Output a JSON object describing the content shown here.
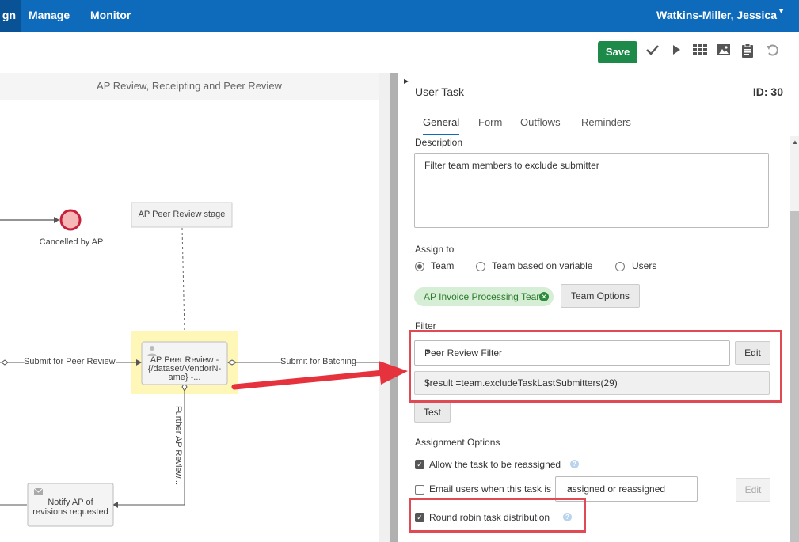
{
  "topbar": {
    "nav_partial": "gn",
    "nav_manage": "Manage",
    "nav_monitor": "Monitor",
    "user": "Watkins-Miller, Jessica"
  },
  "toolbar": {
    "save_label": "Save",
    "icons": [
      "check-icon",
      "play-icon",
      "grid-icon",
      "image-icon",
      "clipboard-icon",
      "undo-icon"
    ]
  },
  "canvas": {
    "header": "AP Review, Receipting and Peer Review",
    "nodes": {
      "cancelled": "Cancelled by AP",
      "stage": "AP Peer Review stage",
      "task_line1": "AP Peer Review -",
      "task_line2": "{/dataset/VendorN-",
      "task_line3": "ame} -...",
      "notify_line1": "Notify AP of",
      "notify_line2": "revisions requested"
    },
    "edges": {
      "submit_peer": "Submit for Peer Review",
      "submit_batching": "Submit for Batching",
      "further": "Further AP Review..."
    }
  },
  "panel": {
    "title": "User Task",
    "id_label": "ID: 30",
    "tabs": [
      "General",
      "Form",
      "Outflows",
      "Reminders"
    ],
    "description_label": "Description",
    "description_value": "Filter team members to exclude submitter",
    "assign_to_label": "Assign to",
    "assign_options": [
      "Team",
      "Team based on variable",
      "Users"
    ],
    "selected_assign": "Team",
    "team_chip": "AP Invoice Processing Team",
    "team_options_button": "Team Options",
    "filter_label": "Filter",
    "filter_select": "Peer Review Filter",
    "filter_edit": "Edit",
    "filter_expression": "$result =team.excludeTaskLastSubmitters(29)",
    "test_button": "Test",
    "assignment_options_label": "Assignment Options",
    "allow_reassign": "Allow the task to be reassigned",
    "email_users": "Email users when this task is",
    "email_dropdown": "assigned or reassigned",
    "email_edit": "Edit",
    "round_robin": "Round robin task distribution",
    "allow_reassign_checked": true,
    "email_users_checked": false,
    "round_robin_checked": true
  },
  "colors": {
    "topbar": "#0e6aba",
    "save": "#1e8a4a",
    "highlight": "#e04a55",
    "chip": "#d7eed6"
  }
}
